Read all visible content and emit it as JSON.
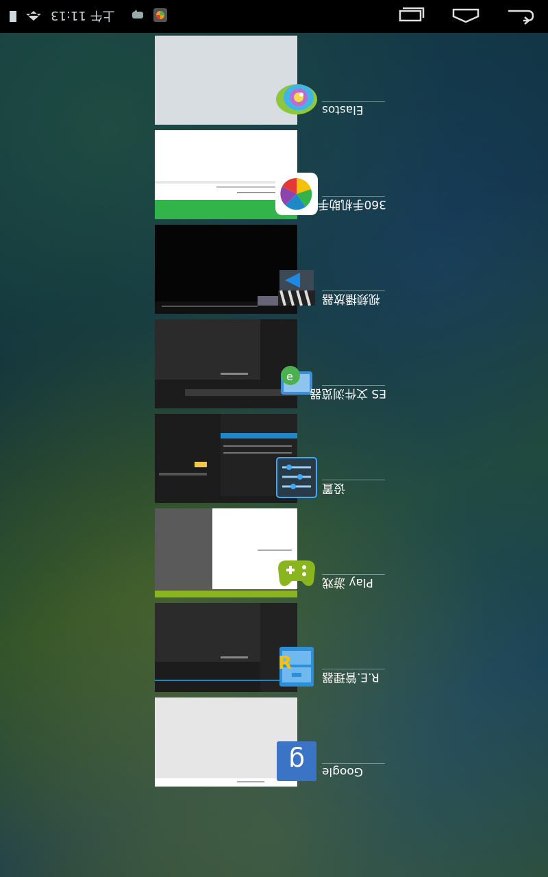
{
  "status_bar": {
    "time": "上午 11:13"
  },
  "recent_apps": [
    {
      "label": "Elastos"
    },
    {
      "label": "360手机助手"
    },
    {
      "label": "视频播放器"
    },
    {
      "label": "ES 文件浏览器"
    },
    {
      "label": "设置"
    },
    {
      "label": "Play 游戏"
    },
    {
      "label": "R.E.管理器"
    },
    {
      "label": "Google"
    }
  ],
  "colors": {
    "status_bar_bg": "#000000",
    "accent_green": "#33b44a",
    "accent_blue": "#1e88c8",
    "play_green": "#8ab51e"
  },
  "icons": [
    "recent-apps-icon",
    "home-icon",
    "back-icon",
    "notification-icon",
    "signal-icon",
    "battery-icon",
    "gallery-icon"
  ]
}
